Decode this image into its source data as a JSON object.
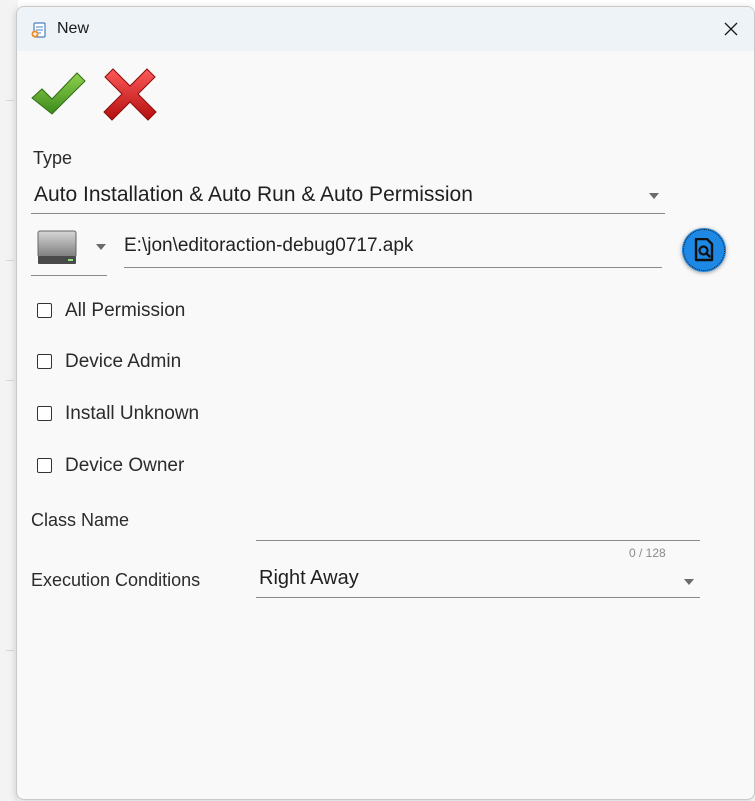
{
  "window": {
    "title": "New",
    "close_glyph": "✕"
  },
  "toolbar": {
    "ok_icon": "green-check-icon",
    "cancel_icon": "red-x-icon"
  },
  "type_field": {
    "label": "Type",
    "value": "Auto Installation & Auto Run & Auto Permission"
  },
  "file": {
    "drive_icon": "hard-drive-icon",
    "path": "E:\\jon\\editoraction-debug0717.apk",
    "browse_icon": "file-search-icon",
    "accent_color": "#1e88e5"
  },
  "permissions": [
    {
      "label": "All Permission",
      "checked": false
    },
    {
      "label": "Device Admin",
      "checked": false
    },
    {
      "label": "Install Unknown",
      "checked": false
    },
    {
      "label": "Device Owner",
      "checked": false
    }
  ],
  "class_name": {
    "label": "Class Name",
    "value": "",
    "counter": "0 / 128"
  },
  "execution_conditions": {
    "label": "Execution Conditions",
    "value": "Right Away"
  }
}
